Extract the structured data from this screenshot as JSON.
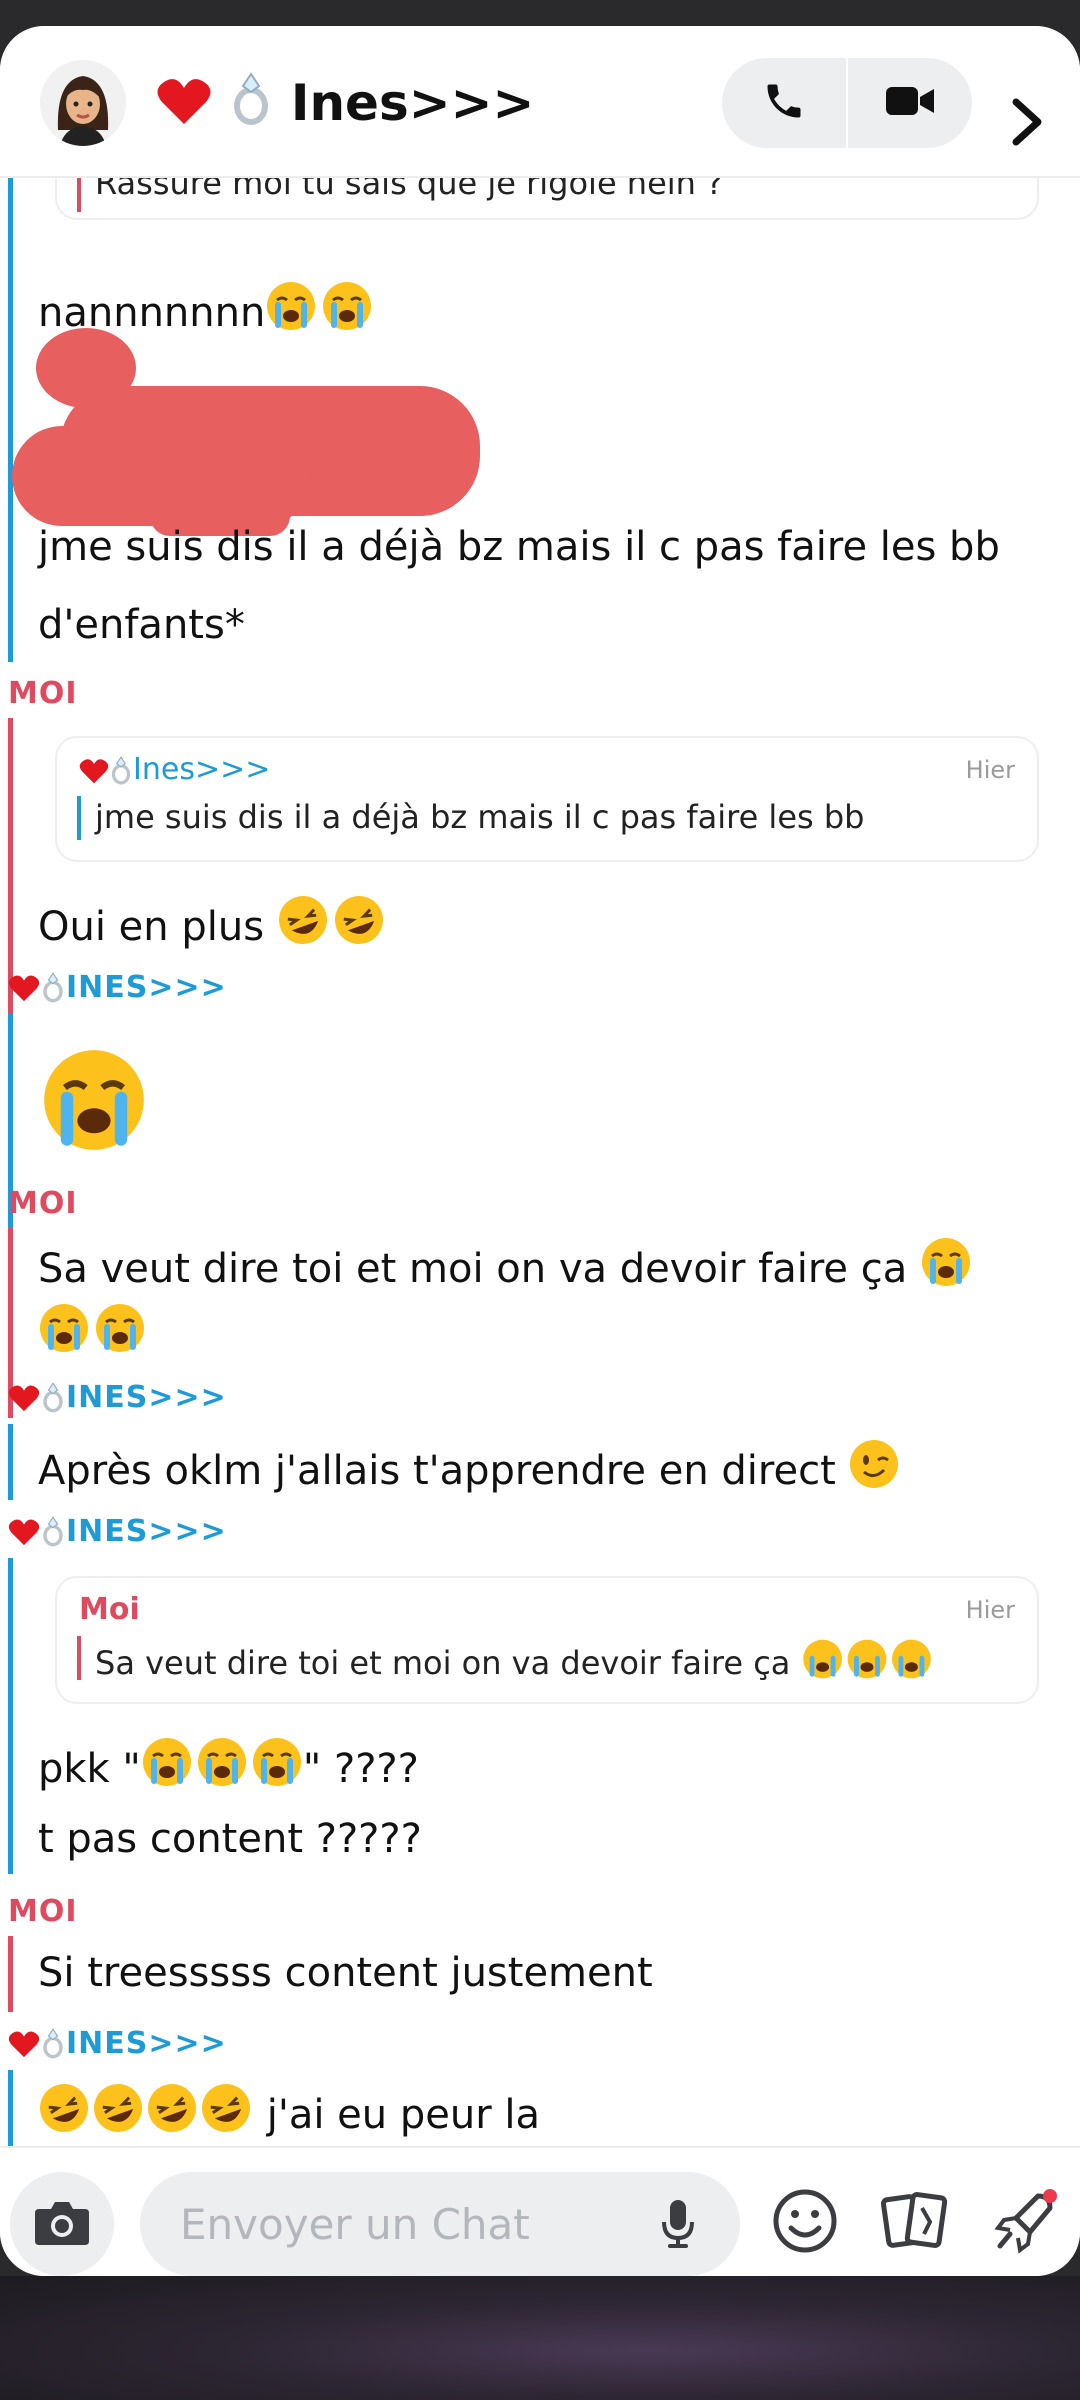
{
  "header": {
    "title": "Ines>>>",
    "contact_emoji": "❤️💍"
  },
  "messages": [
    {
      "type": "quote-snippet",
      "text": "Rassure moi tu sais que je rigole hein ?"
    },
    {
      "type": "text",
      "sender": "her",
      "text": "nannnnnnn"
    },
    {
      "type": "text",
      "sender": "her",
      "text": "jme suis dis il a déjà bz mais il c pas faire les bb"
    },
    {
      "type": "text",
      "sender": "her",
      "text": "d'enfants*"
    },
    {
      "type": "label",
      "sender": "me",
      "label": "MOI"
    },
    {
      "type": "quote",
      "name": "Ines>>>",
      "time": "Hier",
      "text": "jme suis dis il a déjà bz mais il c pas faire les bb"
    },
    {
      "type": "text",
      "sender": "me",
      "text": "Oui en plus"
    },
    {
      "type": "label",
      "sender": "her",
      "label": "INES>>>"
    },
    {
      "type": "label",
      "sender": "me",
      "label": "MOI"
    },
    {
      "type": "text",
      "sender": "me",
      "text": "Sa veut dire toi et moi on va devoir faire ça"
    },
    {
      "type": "label",
      "sender": "her",
      "label": "INES>>>"
    },
    {
      "type": "text",
      "sender": "her",
      "text": "Après oklm j'allais t'apprendre en direct"
    },
    {
      "type": "label",
      "sender": "her",
      "label": "INES>>>"
    },
    {
      "type": "quote",
      "name": "Moi",
      "time": "Hier",
      "text": "Sa veut dire toi et moi on va devoir faire ça"
    },
    {
      "type": "text",
      "sender": "her",
      "text_a": "pkk \"",
      "text_b": "\" ????"
    },
    {
      "type": "text",
      "sender": "her",
      "text": "t pas content ?????"
    },
    {
      "type": "label",
      "sender": "me",
      "label": "MOI"
    },
    {
      "type": "text",
      "sender": "me",
      "text": "Si treesssss content justement"
    },
    {
      "type": "label",
      "sender": "her",
      "label": "INES>>>"
    },
    {
      "type": "text",
      "sender": "her",
      "text": "j'ai eu peur la"
    }
  ],
  "footer": {
    "placeholder": "Envoyer un Chat"
  },
  "colors": {
    "me": "#e04a5f",
    "her": "#1e9bd7",
    "redaction": "#e85f5f"
  }
}
